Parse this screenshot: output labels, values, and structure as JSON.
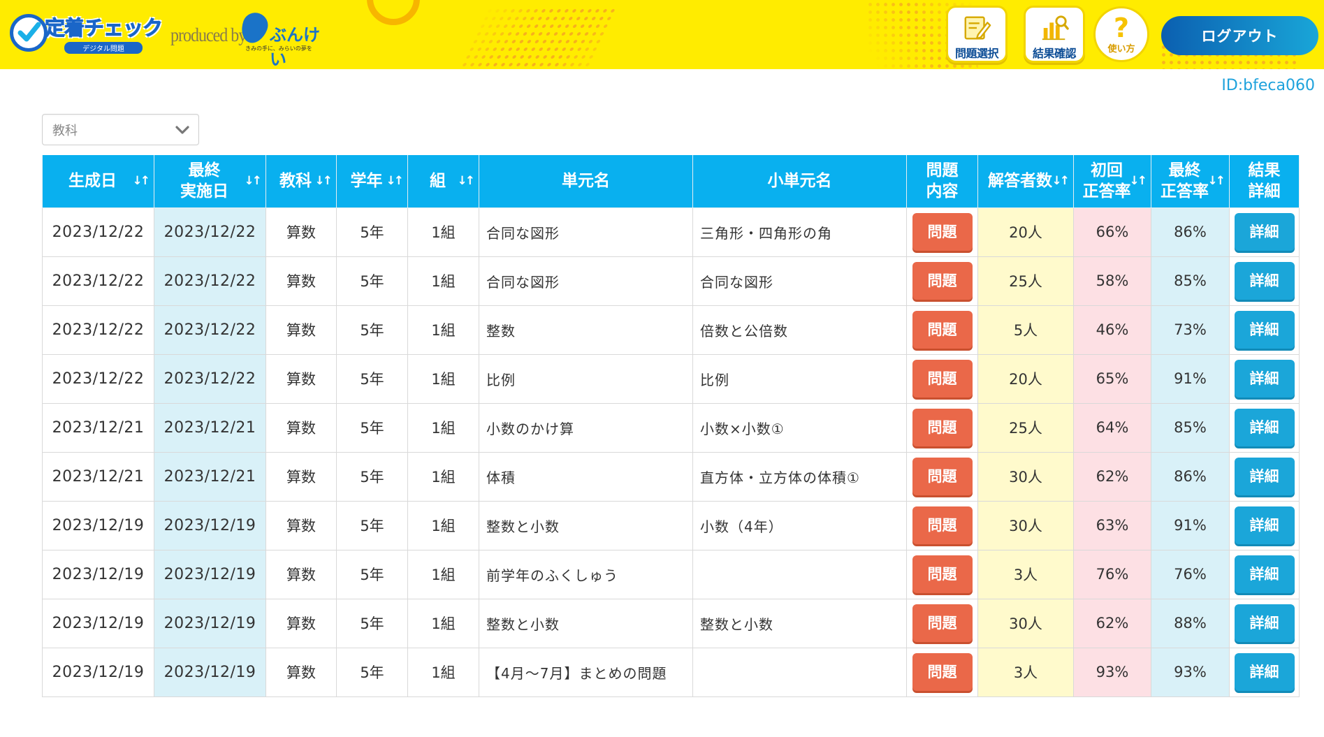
{
  "header": {
    "logo_main": "定着チェック",
    "logo_sub": "デジタル問題",
    "produced_by": "produced by",
    "publisher": "ぶんけい",
    "publisher_tagline": "きみの手に、みらいの夢を",
    "nav": {
      "select_label": "問題選択",
      "result_label": "結果確認",
      "help_label": "使い方",
      "help_mark": "?",
      "logout_label": "ログアウト"
    },
    "colors": {
      "bar": "#ffec00",
      "logout_start": "#0b5fb0",
      "logout_end": "#19a6d8"
    }
  },
  "user_id": "ID:bfeca060",
  "filter": {
    "subject_placeholder": "教科"
  },
  "table": {
    "headers": [
      {
        "label": "生成日",
        "sortable": true
      },
      {
        "label": "最終\n実施日",
        "sortable": true
      },
      {
        "label": "教科",
        "sortable": true
      },
      {
        "label": "学年",
        "sortable": true
      },
      {
        "label": "組",
        "sortable": true
      },
      {
        "label": "単元名",
        "sortable": false
      },
      {
        "label": "小単元名",
        "sortable": false
      },
      {
        "label": "問題\n内容",
        "sortable": false
      },
      {
        "label": "解答者数",
        "sortable": true
      },
      {
        "label": "初回\n正答率",
        "sortable": true
      },
      {
        "label": "最終\n正答率",
        "sortable": true
      },
      {
        "label": "結果\n詳細",
        "sortable": false
      }
    ],
    "sort_icon": "↓↑",
    "question_button": "問題",
    "detail_button": "詳細",
    "rows": [
      {
        "created": "2023/12/22",
        "last": "2023/12/22",
        "subject": "算数",
        "grade": "5年",
        "class": "1組",
        "unit": "合同な図形",
        "subunit": "三角形・四角形の角",
        "respondents": "20人",
        "first_rate": "66%",
        "final_rate": "86%"
      },
      {
        "created": "2023/12/22",
        "last": "2023/12/22",
        "subject": "算数",
        "grade": "5年",
        "class": "1組",
        "unit": "合同な図形",
        "subunit": "合同な図形",
        "respondents": "25人",
        "first_rate": "58%",
        "final_rate": "85%"
      },
      {
        "created": "2023/12/22",
        "last": "2023/12/22",
        "subject": "算数",
        "grade": "5年",
        "class": "1組",
        "unit": "整数",
        "subunit": "倍数と公倍数",
        "respondents": "5人",
        "first_rate": "46%",
        "final_rate": "73%"
      },
      {
        "created": "2023/12/22",
        "last": "2023/12/22",
        "subject": "算数",
        "grade": "5年",
        "class": "1組",
        "unit": "比例",
        "subunit": "比例",
        "respondents": "20人",
        "first_rate": "65%",
        "final_rate": "91%"
      },
      {
        "created": "2023/12/21",
        "last": "2023/12/21",
        "subject": "算数",
        "grade": "5年",
        "class": "1組",
        "unit": "小数のかけ算",
        "subunit": "小数×小数①",
        "respondents": "25人",
        "first_rate": "64%",
        "final_rate": "85%"
      },
      {
        "created": "2023/12/21",
        "last": "2023/12/21",
        "subject": "算数",
        "grade": "5年",
        "class": "1組",
        "unit": "体積",
        "subunit": "直方体・立方体の体積①",
        "respondents": "30人",
        "first_rate": "62%",
        "final_rate": "86%"
      },
      {
        "created": "2023/12/19",
        "last": "2023/12/19",
        "subject": "算数",
        "grade": "5年",
        "class": "1組",
        "unit": "整数と小数",
        "subunit": "小数（4年）",
        "respondents": "30人",
        "first_rate": "63%",
        "final_rate": "91%"
      },
      {
        "created": "2023/12/19",
        "last": "2023/12/19",
        "subject": "算数",
        "grade": "5年",
        "class": "1組",
        "unit": "前学年のふくしゅう",
        "subunit": "",
        "respondents": "3人",
        "first_rate": "76%",
        "final_rate": "76%"
      },
      {
        "created": "2023/12/19",
        "last": "2023/12/19",
        "subject": "算数",
        "grade": "5年",
        "class": "1組",
        "unit": "整数と小数",
        "subunit": "整数と小数",
        "respondents": "30人",
        "first_rate": "62%",
        "final_rate": "88%"
      },
      {
        "created": "2023/12/19",
        "last": "2023/12/19",
        "subject": "算数",
        "grade": "5年",
        "class": "1組",
        "unit": "【4月～7月】まとめの問題",
        "subunit": "",
        "respondents": "3人",
        "first_rate": "93%",
        "final_rate": "93%"
      }
    ]
  }
}
